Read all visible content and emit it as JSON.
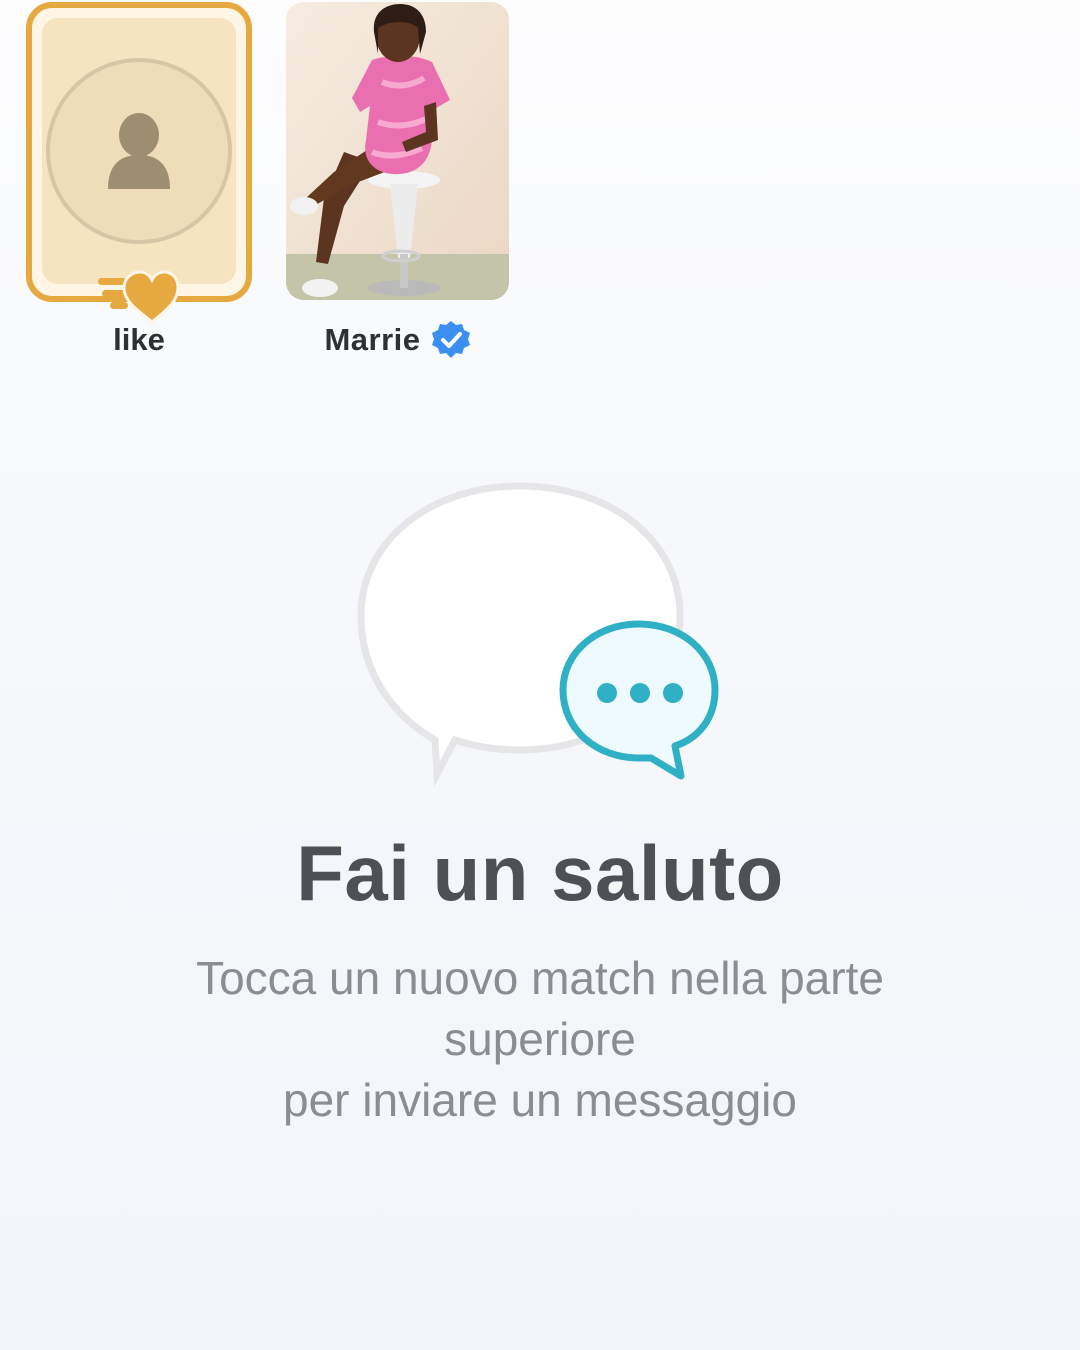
{
  "matches_row": {
    "likes_card": {
      "label": "like",
      "accent_color": "#e6a93f",
      "icon": "heart-icon"
    },
    "matches": [
      {
        "name": "Marrie",
        "verified": true,
        "badge_icon": "verified-badge-icon",
        "badge_color": "#3b8ff0"
      }
    ]
  },
  "empty_state": {
    "illustration": "chat-bubbles-icon",
    "accent_color": "#2fb0c4",
    "title": "Fai un saluto",
    "description_lines": [
      "Tocca un nuovo match nella parte",
      "superiore",
      "per inviare un messaggio"
    ]
  }
}
